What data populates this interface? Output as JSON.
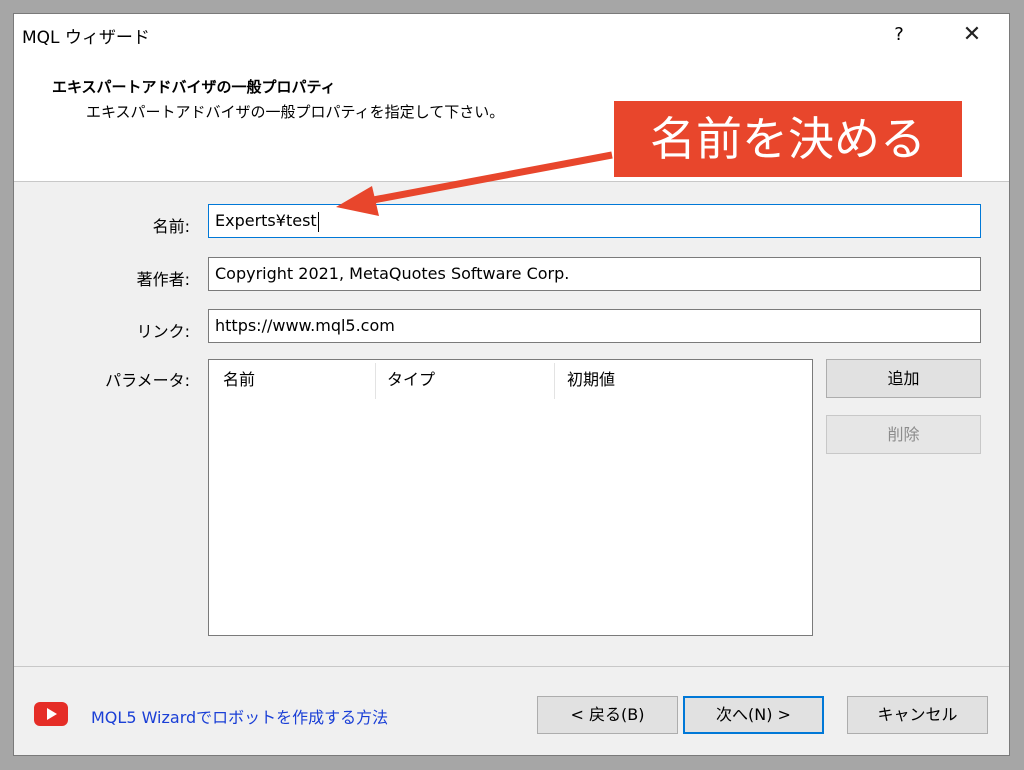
{
  "window": {
    "title": "MQL ウィザード",
    "help": "?",
    "close": "✕"
  },
  "header": {
    "title": "エキスパートアドバイザの一般プロパティ",
    "subtitle": "エキスパートアドバイザの一般プロパティを指定して下さい。"
  },
  "annotation": {
    "text": "名前を決める",
    "color": "#e8462c"
  },
  "form": {
    "name_label": "名前:",
    "name_value": "Experts¥test",
    "author_label": "著作者:",
    "author_value": "Copyright 2021, MetaQuotes Software Corp.",
    "link_label": "リンク:",
    "link_value": "https://www.mql5.com",
    "params_label": "パラメータ:"
  },
  "params_table": {
    "columns": [
      "名前",
      "タイプ",
      "初期値"
    ],
    "rows": []
  },
  "buttons": {
    "add": "追加",
    "delete": "削除",
    "back": "< 戻る(B)",
    "next": "次へ(N) >",
    "cancel": "キャンセル"
  },
  "footer": {
    "link_text": "MQL5 Wizardでロボットを作成する方法",
    "icon": "youtube-icon"
  },
  "colors": {
    "accent": "#0078d7",
    "link": "#1a3fd6",
    "youtube": "#e52d27"
  }
}
